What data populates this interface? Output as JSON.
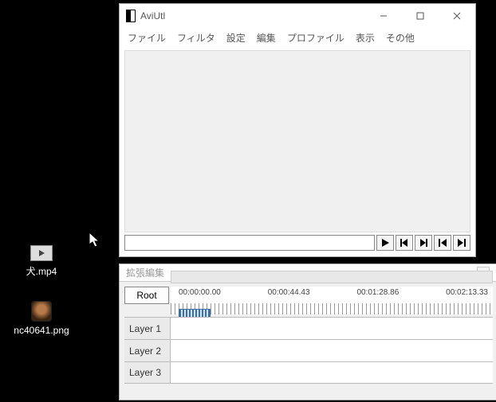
{
  "desktop": {
    "files": [
      {
        "name": "犬.mp4",
        "kind": "video"
      },
      {
        "name": "nc40641.png",
        "kind": "image"
      }
    ]
  },
  "main_window": {
    "title": "AviUtl",
    "menu": [
      "ファイル",
      "フィルタ",
      "設定",
      "編集",
      "プロファイル",
      "表示",
      "その他"
    ],
    "buttons": {
      "play": "play-icon",
      "step_back": "step-back-icon",
      "step_fwd": "step-forward-icon",
      "go_start": "go-start-icon",
      "go_end": "go-end-icon"
    }
  },
  "timeline_window": {
    "title": "拡張編集",
    "root_label": "Root",
    "times": [
      "00:00:00.00",
      "00:00:44.43",
      "00:01:28.86",
      "00:02:13.33"
    ],
    "layers": [
      "Layer 1",
      "Layer 2",
      "Layer 3"
    ]
  }
}
